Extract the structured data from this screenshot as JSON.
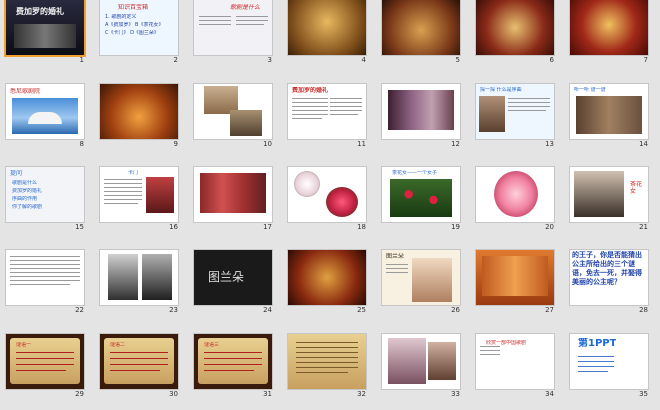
{
  "slides": [
    {
      "n": "1",
      "title": "费加罗的婚礼"
    },
    {
      "n": "2",
      "title": "知识百宝箱",
      "lines": [
        "1. 歌剧的定义",
        "A《费加罗》  B《茶花女》",
        "C《卡门》  D《图兰朵》"
      ]
    },
    {
      "n": "3",
      "title": "歌剧是什么"
    },
    {
      "n": "4"
    },
    {
      "n": "5"
    },
    {
      "n": "6"
    },
    {
      "n": "7"
    },
    {
      "n": "8",
      "title": "悉尼歌剧院"
    },
    {
      "n": "9"
    },
    {
      "n": "10"
    },
    {
      "n": "11",
      "title": "费加罗的婚礼"
    },
    {
      "n": "12"
    },
    {
      "n": "13",
      "title": "探一探 什么是序曲"
    },
    {
      "n": "14",
      "title": "听一听 谱一谱"
    },
    {
      "n": "15",
      "title": "提问",
      "lines": [
        "歌剧是什么",
        "费加罗的婚礼",
        "序曲的作用",
        "你了解的歌剧"
      ]
    },
    {
      "n": "16",
      "title": "卡门"
    },
    {
      "n": "17"
    },
    {
      "n": "18"
    },
    {
      "n": "19",
      "title": "茶花女——一个女子"
    },
    {
      "n": "20"
    },
    {
      "n": "21",
      "title": "茶花女"
    },
    {
      "n": "22"
    },
    {
      "n": "23"
    },
    {
      "n": "24",
      "title": "图兰朵"
    },
    {
      "n": "25"
    },
    {
      "n": "26",
      "title": "图兰朵"
    },
    {
      "n": "27"
    },
    {
      "n": "28",
      "title": "的王子，你是否能猜出公主所给出的三个谜语，免去一死，并娶得美丽的公主呢？"
    },
    {
      "n": "29",
      "title": "谜语一"
    },
    {
      "n": "30",
      "title": "谜语二"
    },
    {
      "n": "31",
      "title": "谜语三"
    },
    {
      "n": "32"
    },
    {
      "n": "33"
    },
    {
      "n": "34",
      "title": "欣赏一部中国歌剧"
    },
    {
      "n": "35",
      "title": "第1PPT"
    }
  ],
  "colors": {
    "accent_red": "#cc2a2a",
    "blue_text": "#2244aa",
    "selection": "#f0a030"
  }
}
